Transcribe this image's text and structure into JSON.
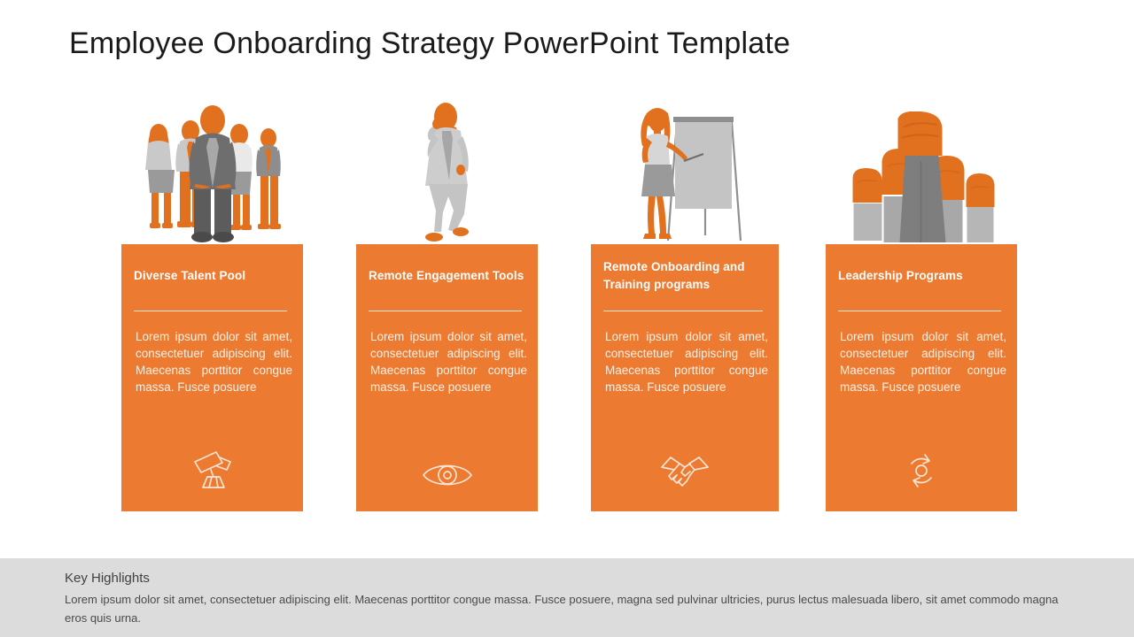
{
  "slide": {
    "title": "Employee Onboarding Strategy PowerPoint Template",
    "accent_color": "#ec7a30",
    "accent_gray": "#9a9a9a",
    "footer_band_color": "#dcdcdc"
  },
  "columns": [
    {
      "illustration_name": "business-team-group-illustration",
      "heading": "Diverse Talent Pool",
      "body": "Lorem ipsum dolor sit amet, consectetuer adipiscing elit. Maecenas porttitor congue massa. Fusce posuere",
      "icon": "telescope-icon"
    },
    {
      "illustration_name": "businessman-on-phone-illustration",
      "heading": "Remote Engagement Tools",
      "body": "Lorem ipsum dolor sit amet, consectetuer adipiscing elit. Maecenas porttitor congue massa. Fusce posuere",
      "icon": "eye-icon"
    },
    {
      "illustration_name": "woman-presenting-flipchart-illustration",
      "heading": "Remote Onboarding and Training programs",
      "body": "Lorem ipsum dolor sit amet, consectetuer adipiscing elit. Maecenas porttitor congue massa. Fusce posuere",
      "icon": "handshake-icon"
    },
    {
      "illustration_name": "raised-fists-illustration",
      "heading": "Leadership Programs",
      "body": "Lorem ipsum dolor sit amet, consectetuer adipiscing elit. Maecenas porttitor congue massa. Fusce posuere",
      "icon": "recycle-arrows-icon"
    }
  ],
  "footer": {
    "title": "Key Highlights",
    "text": "Lorem ipsum dolor sit amet, consectetuer adipiscing elit. Maecenas porttitor congue massa. Fusce posuere, magna sed pulvinar ultricies, purus lectus malesuada libero, sit amet commodo magna eros quis urna."
  }
}
